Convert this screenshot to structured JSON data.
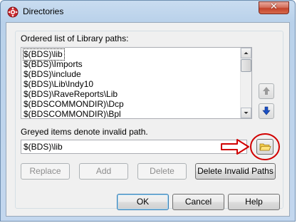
{
  "window": {
    "title": "Directories",
    "close_label": "✕"
  },
  "library": {
    "group_label": "Ordered list of Library paths:",
    "items": [
      "$(BDS)\\lib",
      "$(BDS)\\Imports",
      "$(BDS)\\include",
      "$(BDS)\\Lib\\Indy10",
      "$(BDS)\\RaveReports\\Lib",
      "$(BDSCOMMONDIR)\\Dcp",
      "$(BDSCOMMONDIR)\\Bpl"
    ],
    "hint": "Greyed items denote invalid path.",
    "path_value": "$(BDS)\\lib"
  },
  "buttons": {
    "replace": "Replace",
    "add": "Add",
    "delete": "Delete",
    "delete_invalid": "Delete Invalid Paths",
    "ok": "OK",
    "cancel": "Cancel",
    "help": "Help"
  },
  "icons": {
    "app": "delphi-app-icon",
    "move_up": "arrow-up-icon",
    "move_down": "arrow-down-icon",
    "browse": "folder-icon",
    "annotation_arrow": "red-arrow-annotation",
    "annotation_circle": "red-circle-annotation"
  },
  "colors": {
    "annotation_red": "#d10000",
    "move_down_blue": "#1a4fc4",
    "folder_yellow": "#f2cc4a"
  }
}
